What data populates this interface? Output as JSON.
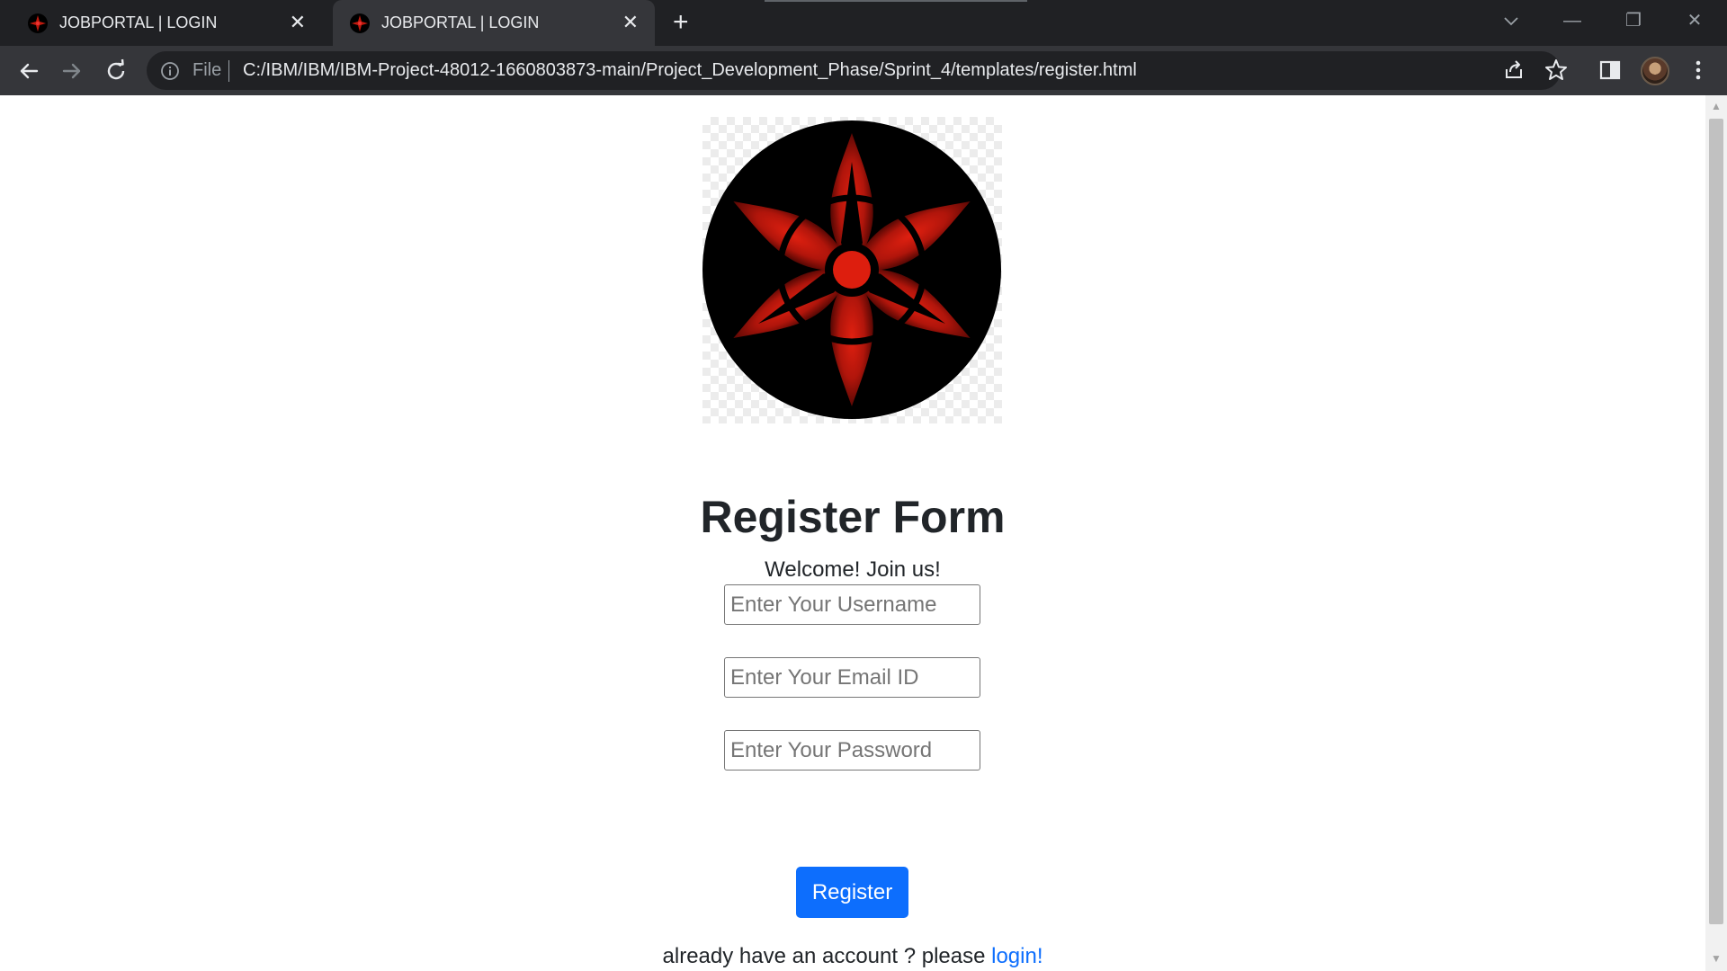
{
  "browser": {
    "tabs": [
      {
        "title": "JOBPORTAL | LOGIN",
        "close": "✕",
        "active": false
      },
      {
        "title": "JOBPORTAL | LOGIN",
        "close": "✕",
        "active": true
      }
    ],
    "new_tab": "+",
    "scheme": "File",
    "url": "C:/IBM/IBM/IBM-Project-48012-1660803873-main/Project_Development_Phase/Sprint_4/templates/register.html",
    "window_controls": {
      "minimize": "—",
      "restore": "❐",
      "close": "✕"
    }
  },
  "page": {
    "heading": "Register Form",
    "welcome": "Welcome! Join us!",
    "fields": {
      "username_placeholder": "Enter Your Username",
      "email_placeholder": "Enter Your Email ID",
      "password_placeholder": "Enter Your Password"
    },
    "register_label": "Register",
    "footer_text": "already have an account ? please ",
    "login_link": "login!"
  },
  "colors": {
    "accent": "#0d6efd",
    "logo_red": "#c01a0e",
    "logo_black": "#000000"
  },
  "icons": [
    "favicon-icon",
    "back-arrow-icon",
    "forward-arrow-icon",
    "reload-icon",
    "info-icon",
    "share-icon",
    "bookmark-star-icon",
    "side-panel-icon",
    "profile-avatar",
    "kebab-menu-icon",
    "tab-search-icon"
  ]
}
